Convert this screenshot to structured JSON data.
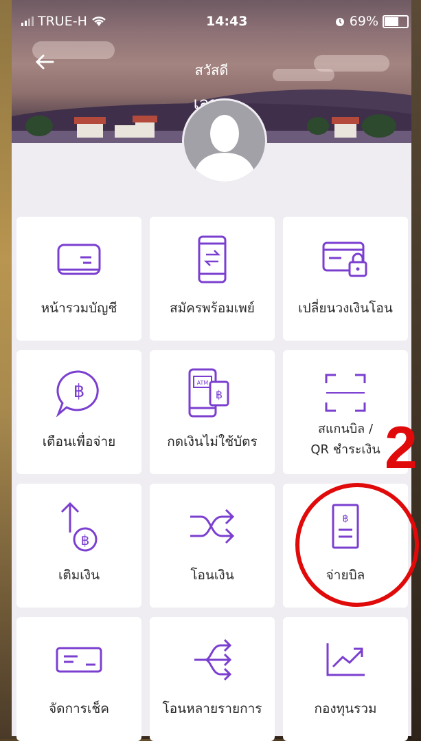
{
  "status_bar": {
    "carrier": "TRUE-H",
    "time": "14:43",
    "battery": "69%"
  },
  "header": {
    "greeting": "สวัสดี",
    "username": "เลขา"
  },
  "menu": [
    {
      "label": "หน้ารวมบัญชี",
      "icon": "account-card-icon"
    },
    {
      "label": "สมัครพร้อมเพย์",
      "icon": "phone-transfer-icon"
    },
    {
      "label": "เปลี่ยนวงเงินโอน",
      "icon": "card-lock-icon"
    },
    {
      "label": "เตือนเพื่อจ่าย",
      "icon": "baht-bubble-icon"
    },
    {
      "label": "กดเงินไม่ใช้บัตร",
      "icon": "atm-cardless-icon"
    },
    {
      "label": "สแกนบิล /\nQR ชำระเงิน",
      "icon": "scan-frame-icon"
    },
    {
      "label": "เติมเงิน",
      "icon": "topup-baht-icon"
    },
    {
      "label": "โอนเงิน",
      "icon": "transfer-arrows-icon"
    },
    {
      "label": "จ่ายบิล",
      "icon": "bill-icon"
    },
    {
      "label": "จัดการเช็ค",
      "icon": "cheque-icon"
    },
    {
      "label": "โอนหลายรายการ",
      "icon": "multi-transfer-icon"
    },
    {
      "label": "กองทุนรวม",
      "icon": "fund-chart-icon"
    }
  ],
  "annotation": {
    "step": "2"
  },
  "colors": {
    "accent": "#7b3fd0",
    "highlight": "#e10a0a"
  }
}
